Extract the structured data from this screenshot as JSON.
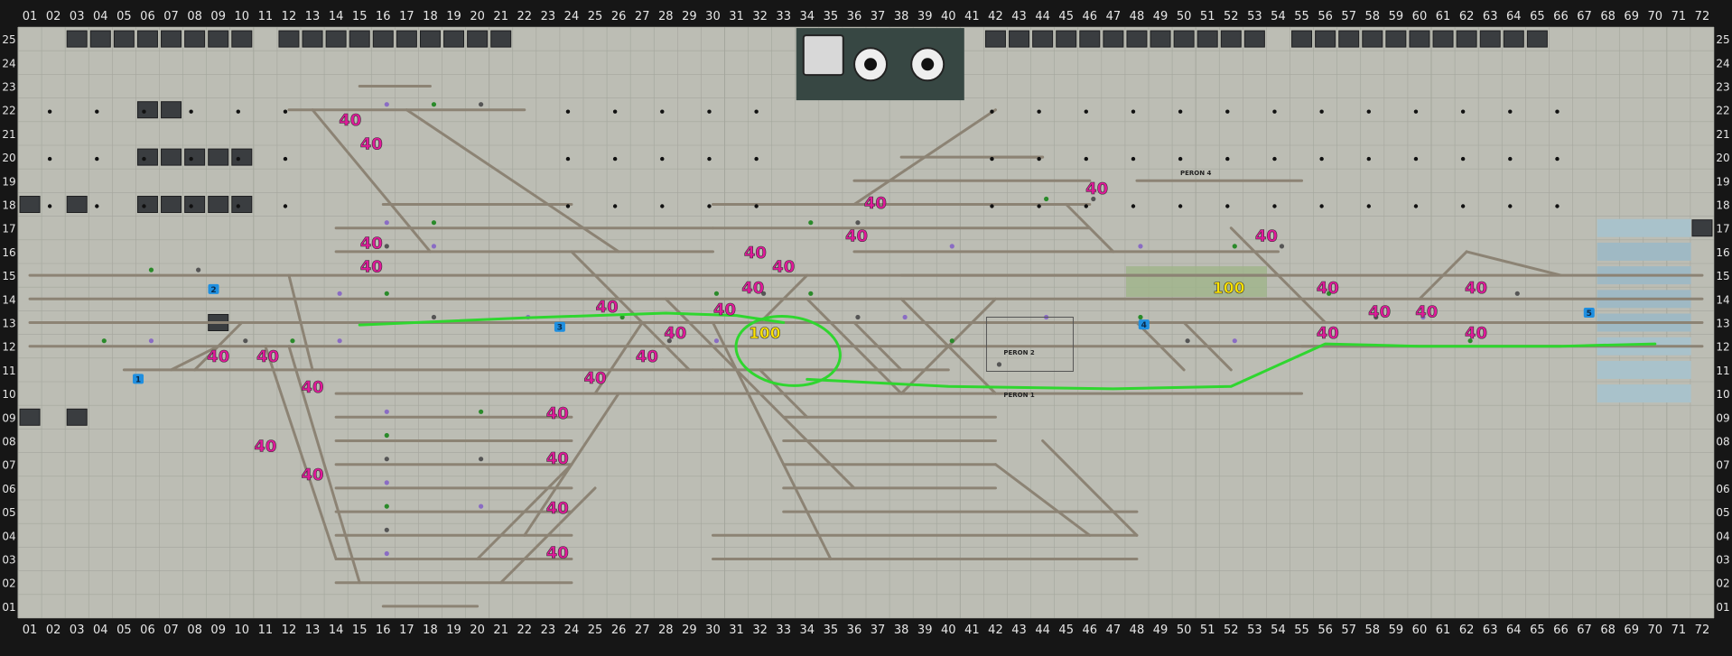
{
  "window": {
    "title": "Signal Box Panel"
  },
  "grid": {
    "columns": [
      "01",
      "02",
      "03",
      "04",
      "05",
      "06",
      "07",
      "08",
      "09",
      "10",
      "11",
      "12",
      "13",
      "14",
      "15",
      "16",
      "17",
      "18",
      "19",
      "20",
      "21",
      "22",
      "23",
      "24",
      "25",
      "26",
      "27",
      "28",
      "29",
      "30",
      "31",
      "32",
      "33",
      "34",
      "35",
      "36",
      "37",
      "38",
      "39",
      "40",
      "41",
      "42",
      "43",
      "44",
      "45",
      "46",
      "47",
      "48",
      "49",
      "50",
      "51",
      "52",
      "53",
      "54",
      "55",
      "56",
      "57",
      "58",
      "59",
      "60",
      "61",
      "62",
      "63",
      "64",
      "65",
      "66",
      "67",
      "68",
      "69",
      "70",
      "71",
      "72"
    ],
    "rows": [
      "25",
      "24",
      "23",
      "22",
      "21",
      "20",
      "19",
      "18",
      "17",
      "16",
      "15",
      "14",
      "13",
      "12",
      "11",
      "10",
      "09",
      "08",
      "07",
      "06",
      "05",
      "04",
      "03",
      "02",
      "01"
    ]
  },
  "platforms": [
    {
      "label": "PERON 4",
      "col": 50.5,
      "row": 19.4
    },
    {
      "label": "PERON 2",
      "col": 43.0,
      "row": 11.8
    },
    {
      "label": "PERON 1",
      "col": 43.0,
      "row": 10.0
    }
  ],
  "speed_markers": [
    {
      "value": "40",
      "col": 14.6,
      "row": 21.6
    },
    {
      "value": "40",
      "col": 15.5,
      "row": 20.6
    },
    {
      "value": "40",
      "col": 15.5,
      "row": 16.4
    },
    {
      "value": "40",
      "col": 15.5,
      "row": 15.4
    },
    {
      "value": "40",
      "col": 25.5,
      "row": 13.7
    },
    {
      "value": "40",
      "col": 28.4,
      "row": 12.6
    },
    {
      "value": "40",
      "col": 27.2,
      "row": 11.6
    },
    {
      "value": "40",
      "col": 25.0,
      "row": 10.7
    },
    {
      "value": "40",
      "col": 23.4,
      "row": 9.2
    },
    {
      "value": "40",
      "col": 23.4,
      "row": 7.3
    },
    {
      "value": "40",
      "col": 23.4,
      "row": 5.2
    },
    {
      "value": "40",
      "col": 23.4,
      "row": 3.3
    },
    {
      "value": "40",
      "col": 9.0,
      "row": 11.6
    },
    {
      "value": "40",
      "col": 11.1,
      "row": 11.6
    },
    {
      "value": "40",
      "col": 13.0,
      "row": 10.3
    },
    {
      "value": "40",
      "col": 11.0,
      "row": 7.8
    },
    {
      "value": "40",
      "col": 13.0,
      "row": 6.6
    },
    {
      "value": "40",
      "col": 31.8,
      "row": 16.0
    },
    {
      "value": "40",
      "col": 33.0,
      "row": 15.4
    },
    {
      "value": "40",
      "col": 31.7,
      "row": 14.5
    },
    {
      "value": "40",
      "col": 30.5,
      "row": 13.6
    },
    {
      "value": "40",
      "col": 36.9,
      "row": 18.1
    },
    {
      "value": "40",
      "col": 36.1,
      "row": 16.7
    },
    {
      "value": "40",
      "col": 46.3,
      "row": 18.7
    },
    {
      "value": "40",
      "col": 53.5,
      "row": 16.7
    },
    {
      "value": "40",
      "col": 56.1,
      "row": 14.5
    },
    {
      "value": "40",
      "col": 58.3,
      "row": 13.5
    },
    {
      "value": "40",
      "col": 60.3,
      "row": 13.5
    },
    {
      "value": "40",
      "col": 62.4,
      "row": 14.5
    },
    {
      "value": "40",
      "col": 56.1,
      "row": 12.6
    },
    {
      "value": "40",
      "col": 62.4,
      "row": 12.6
    },
    {
      "value": "100",
      "col": 32.2,
      "row": 12.6
    },
    {
      "value": "100",
      "col": 51.9,
      "row": 14.5
    }
  ],
  "route_markers": [
    {
      "label": "1",
      "col": 5.6,
      "row": 10.6
    },
    {
      "label": "2",
      "col": 8.8,
      "row": 14.4
    },
    {
      "label": "3",
      "col": 23.5,
      "row": 12.8
    },
    {
      "label": "4",
      "col": 48.3,
      "row": 12.9
    },
    {
      "label": "5",
      "col": 67.2,
      "row": 13.4
    }
  ],
  "colors": {
    "background": "#161616",
    "panel": "#bcbdb4",
    "track": "#8c8374",
    "speed_40": "#e0199a",
    "speed_100": "#ffe400",
    "route_highlight": "#2fd62f",
    "module": "#374743"
  }
}
